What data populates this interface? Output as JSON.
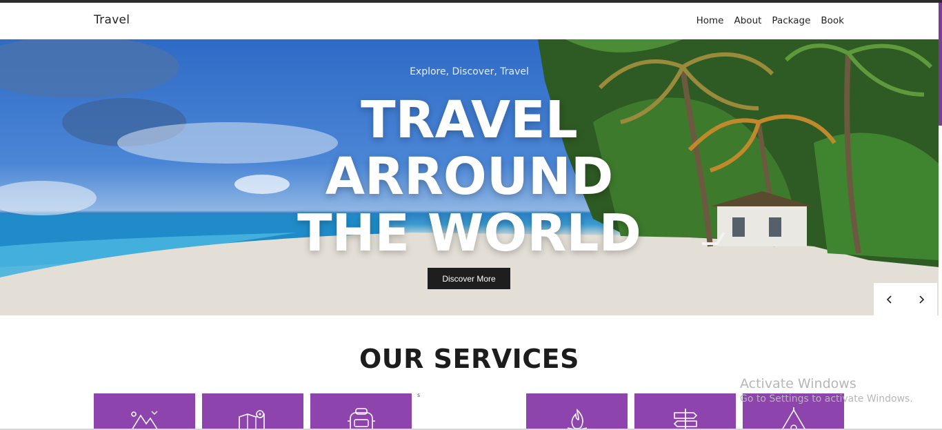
{
  "brand": "Travel",
  "nav": [
    "Home",
    "About",
    "Package",
    "Book"
  ],
  "hero": {
    "subtitle": "Explore, Discover, Travel",
    "title_lines": [
      "TRAVEL",
      "ARROUND",
      "THE WORLD"
    ],
    "cta": "Discover More"
  },
  "carousel": {
    "prev_icon": "chevron-left-icon",
    "next_icon": "chevron-right-icon"
  },
  "services": {
    "title": "OUR SERVICES",
    "stray_char": "s",
    "cards": [
      {
        "icon": "mountain-icon"
      },
      {
        "icon": "map-icon"
      },
      {
        "icon": "backpack-icon"
      },
      {
        "icon": "campfire-icon"
      },
      {
        "icon": "signpost-icon"
      },
      {
        "icon": "tent-icon"
      }
    ]
  },
  "colors": {
    "accent": "#8e44ad",
    "button": "#1e1e1e",
    "topbar": "#2b2b2b"
  },
  "watermark": {
    "line1": "Activate Windows",
    "line2": "Go to Settings to activate Windows."
  }
}
